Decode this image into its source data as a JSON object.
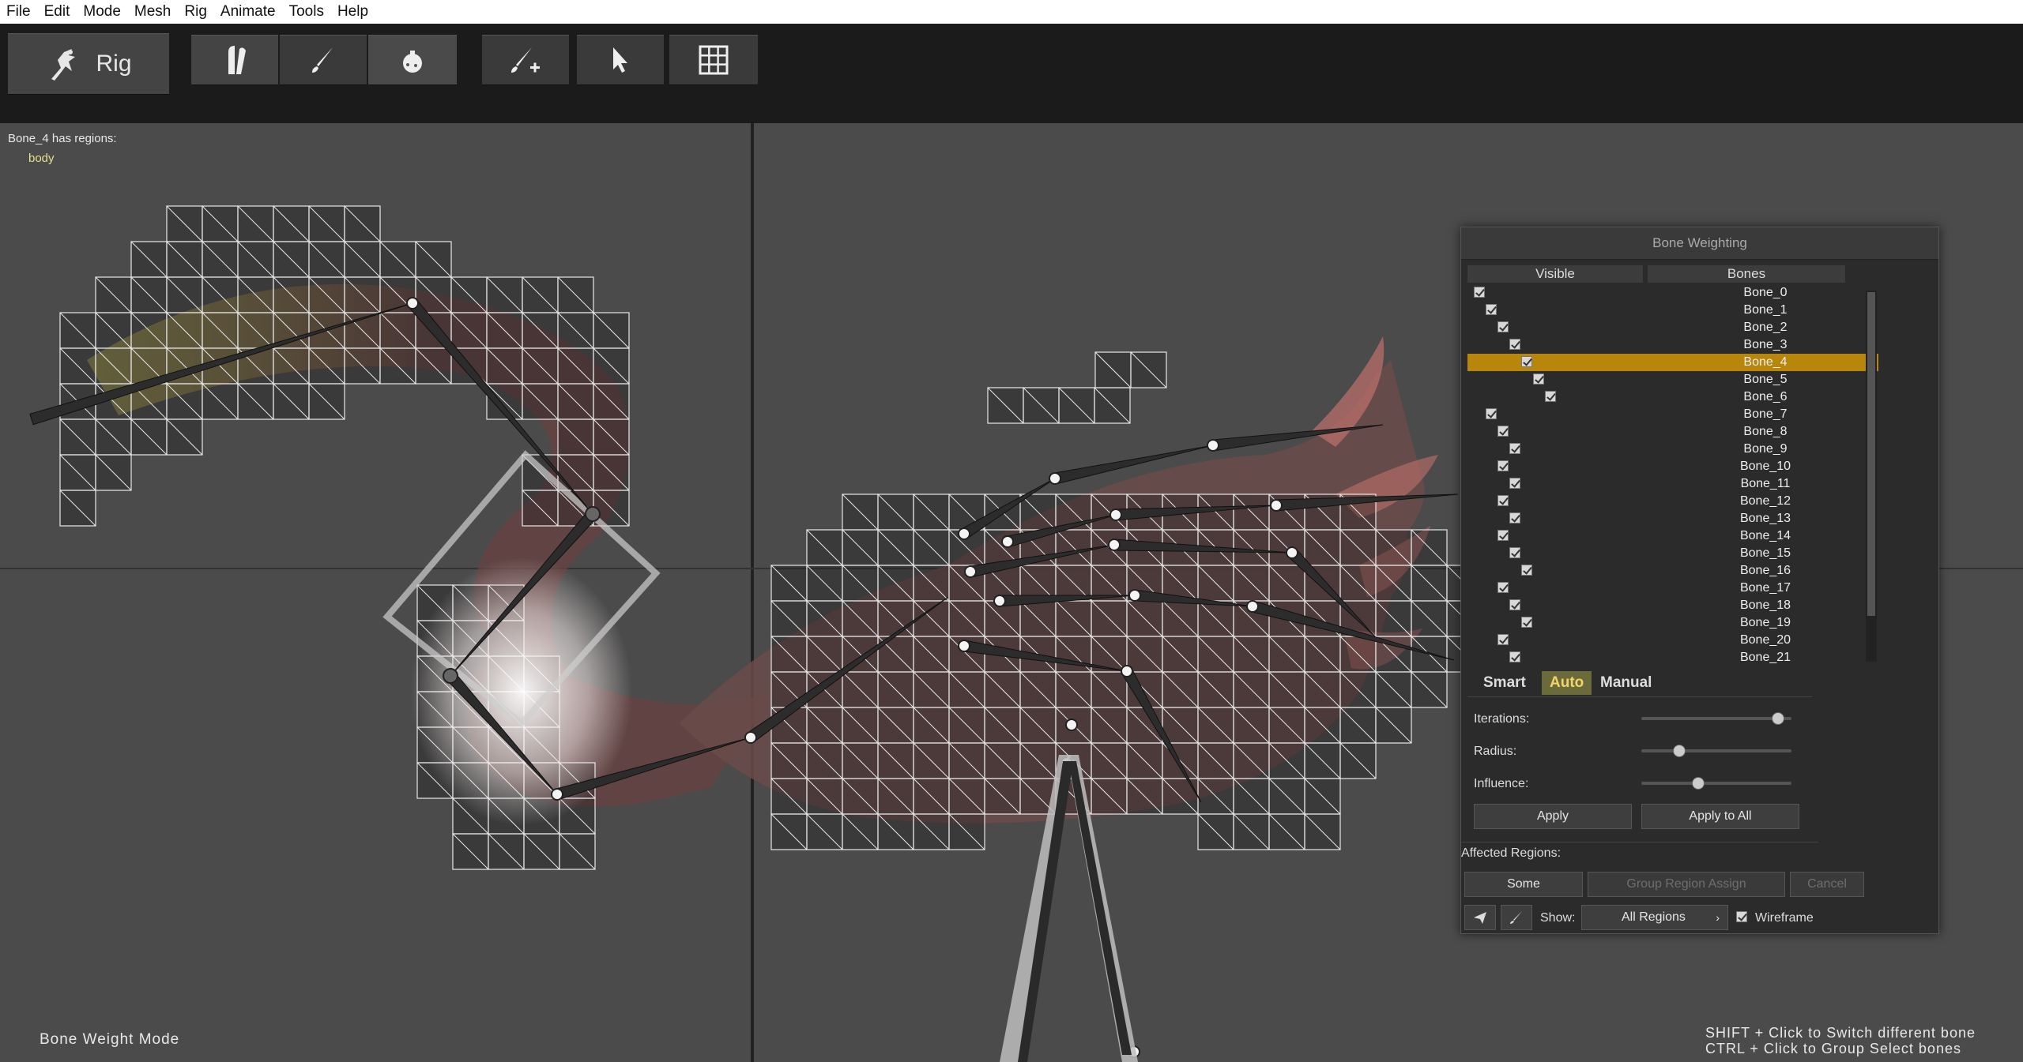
{
  "menu": [
    "File",
    "Edit",
    "Mode",
    "Mesh",
    "Rig",
    "Animate",
    "Tools",
    "Help"
  ],
  "toolbar": {
    "rig_label": "Rig",
    "tools": [
      "bone-tool-icon",
      "brush-icon",
      "bomb-icon",
      "add-brush-icon",
      "pointer-icon",
      "grid-icon"
    ]
  },
  "viewport": {
    "info_title": "Bone_4 has regions:",
    "info_region": "body",
    "mode_label": "Bone Weight Mode",
    "hint_shift": "SHIFT + Click to Switch different bone",
    "hint_ctrl": "CTRL + Click to Group Select bones"
  },
  "panel": {
    "title": "Bone Weighting",
    "col_visible": "Visible",
    "col_bones": "Bones",
    "bones": [
      "Bone_0",
      "Bone_1",
      "Bone_2",
      "Bone_3",
      "Bone_4",
      "Bone_5",
      "Bone_6",
      "Bone_7",
      "Bone_8",
      "Bone_9",
      "Bone_10",
      "Bone_11",
      "Bone_12",
      "Bone_13",
      "Bone_14",
      "Bone_15",
      "Bone_16",
      "Bone_17",
      "Bone_18",
      "Bone_19",
      "Bone_20",
      "Bone_21"
    ],
    "selected_bone": "Bone_4",
    "tabs": [
      "Smart",
      "Auto",
      "Manual"
    ],
    "active_tab": "Auto",
    "params": {
      "iterations_label": "Iterations:",
      "radius_label": "Radius:",
      "influence_label": "Influence:",
      "iterations_value": 0.95,
      "radius_value": 0.23,
      "influence_value": 0.37
    },
    "apply_label": "Apply",
    "apply_all_label": "Apply to All",
    "affected_label": "Affected Regions:",
    "some_label": "Some",
    "group_assign_label": "Group Region Assign",
    "cancel_label": "Cancel",
    "show_label": "Show:",
    "show_value": "All Regions",
    "wireframe_label": "Wireframe"
  },
  "colors": {
    "selected_row": "#b8860b",
    "active_tab_text": "#f0d56b",
    "region_text": "#e6e08a"
  }
}
